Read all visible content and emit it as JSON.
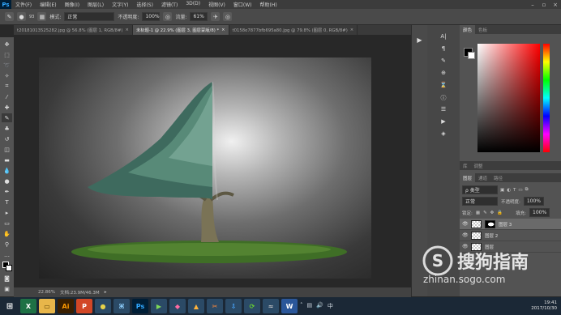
{
  "app": {
    "logo": "Ps"
  },
  "menu": [
    "文件(F)",
    "编辑(E)",
    "图像(I)",
    "图层(L)",
    "文字(Y)",
    "选择(S)",
    "滤镜(T)",
    "3D(D)",
    "视图(V)",
    "窗口(W)",
    "帮助(H)"
  ],
  "options": {
    "mode_label": "模式:",
    "mode_value": "正常",
    "opacity_label": "不透明度:",
    "opacity_value": "100%",
    "flow_label": "流量:",
    "flow_value": "61%",
    "brush_size": "93"
  },
  "tabs": [
    {
      "label": "t20181013525282.jpg @ 56.8% (图层 1, RGB/8#)",
      "close": "×"
    },
    {
      "label": "未标题-1 @ 22.9% (图层 3, 图层蒙版/8) *",
      "close": "×"
    },
    {
      "label": "t0158e7877bfb695a80.jpg @ 79.8% (图层 0, RGB/8#)",
      "close": "×"
    }
  ],
  "status": {
    "zoom": "22.86%",
    "doc": "文档:23.9M/46.3M"
  },
  "color_panel": {
    "tabs": [
      "颜色",
      "色板"
    ]
  },
  "lib_panel": {
    "tabs": [
      "库",
      "调整"
    ]
  },
  "layers_panel": {
    "tabs": [
      "图层",
      "通道",
      "路径"
    ],
    "kind_label": "ρ 类型",
    "blend_mode": "正常",
    "opacity_label": "不透明度:",
    "opacity_value": "100%",
    "lock_label": "锁定:",
    "fill_label": "填充:",
    "fill_value": "100%",
    "layers": [
      {
        "name": "图层 3",
        "selected": true,
        "has_mask": true
      },
      {
        "name": "图层 2",
        "selected": false,
        "has_mask": false
      },
      {
        "name": "图层",
        "selected": false,
        "has_mask": false
      }
    ]
  },
  "watermark": {
    "brand": "搜狗指南",
    "url": "zhinan.sogo.com"
  },
  "taskbar": {
    "apps": [
      {
        "label": "X",
        "bg": "#1e7145",
        "fg": "#ffffff",
        "icon": "excel-icon"
      },
      {
        "label": "▭",
        "bg": "#e8b64a",
        "fg": "#5a3d00",
        "icon": "file-explorer-icon"
      },
      {
        "label": "Ai",
        "bg": "#3a1f00",
        "fg": "#ff9a00",
        "icon": "illustrator-icon"
      },
      {
        "label": "P",
        "bg": "#d24726",
        "fg": "#ffffff",
        "icon": "powerpoint-icon"
      },
      {
        "label": "●",
        "bg": "#2b4a66",
        "fg": "#e6d24a",
        "icon": "media-icon"
      },
      {
        "label": "⌘",
        "bg": "#2b4a66",
        "fg": "#8fd0ff",
        "icon": "baidu-icon"
      },
      {
        "label": "Ps",
        "bg": "#001e36",
        "fg": "#31a8ff",
        "icon": "photoshop-icon"
      },
      {
        "label": "▶",
        "bg": "#2b4a66",
        "fg": "#7ed957",
        "icon": "player-icon"
      },
      {
        "label": "◆",
        "bg": "#2b4a66",
        "fg": "#ff6aa2",
        "icon": "app-icon"
      },
      {
        "label": "▲",
        "bg": "#2b4a66",
        "fg": "#ffb33a",
        "icon": "app2-icon"
      },
      {
        "label": "✂",
        "bg": "#2b4a66",
        "fg": "#ff8a3a",
        "icon": "snip-icon"
      },
      {
        "label": "⇩",
        "bg": "#2b4a66",
        "fg": "#4aa8ff",
        "icon": "download-icon"
      },
      {
        "label": "⟳",
        "bg": "#2b4a66",
        "fg": "#66cc33",
        "icon": "refresh-icon"
      },
      {
        "label": "≈",
        "bg": "#2b4a66",
        "fg": "#c9c9c9",
        "icon": "network-icon"
      },
      {
        "label": "W",
        "bg": "#2b579a",
        "fg": "#ffffff",
        "icon": "word-icon"
      }
    ],
    "time": "19:41",
    "date": "2017/10/30"
  }
}
